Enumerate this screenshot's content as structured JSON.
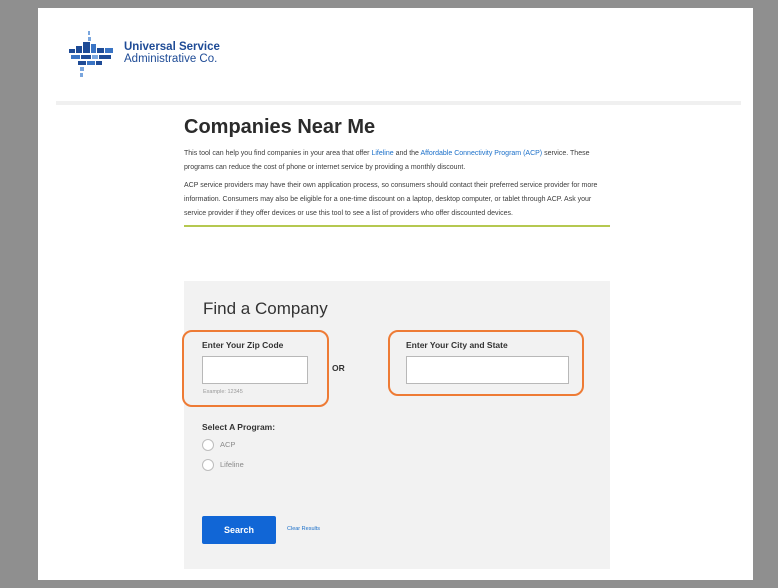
{
  "logo": {
    "line1": "Universal Service",
    "line2": "Administrative Co.",
    "icon": "usac-logo-icon"
  },
  "page": {
    "title": "Companies Near Me",
    "para1": {
      "t1": "This tool can help you find companies in your area that offer ",
      "link1": "Lifeline",
      "t2": " and the ",
      "link2": "Affordable Connectivity Program (ACP)",
      "t3": " service. These programs can reduce the cost of phone or internet service by providing a monthly discount."
    },
    "para2": "ACP service providers may have their own application process, so consumers should contact their preferred service provider for more information. Consumers may also be eligible for a one-time discount on a laptop, desktop computer, or tablet through ACP. Ask your service provider if they offer devices or use this tool to see a list of providers who offer discounted devices."
  },
  "form": {
    "title": "Find a Company",
    "zip_label": "Enter Your Zip Code",
    "zip_value": "",
    "zip_hint": "Example: 12345",
    "or": "OR",
    "city_label": "Enter Your City and State",
    "city_value": "",
    "program_label": "Select A Program:",
    "programs": [
      "ACP",
      "Lifeline"
    ],
    "search_label": "Search",
    "clear_label": "Clear Results"
  },
  "colors": {
    "accent": "#1166d6",
    "highlight": "#ee7b35",
    "divider": "#b5c850",
    "brand": "#1e4b96"
  }
}
